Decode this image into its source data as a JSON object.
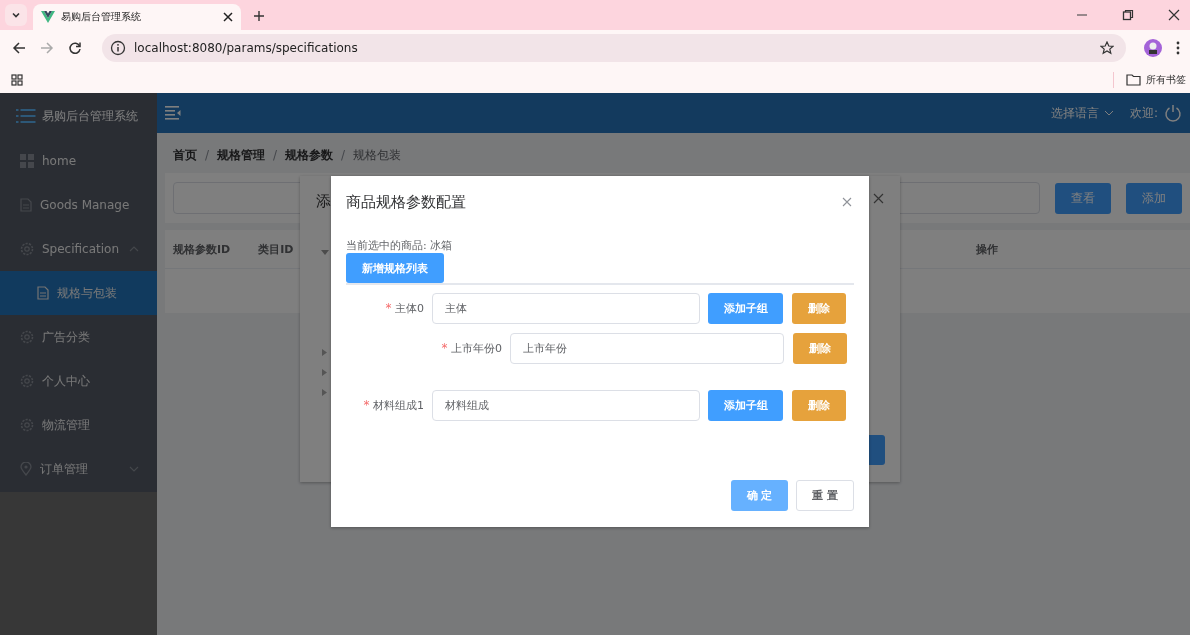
{
  "browser": {
    "tab_title": "易购后台管理系统",
    "url": "localhost:8080/params/specifications",
    "bookmarks_label": "所有书签"
  },
  "sidebar": {
    "title": "易购后台管理系统",
    "items": [
      {
        "label": "home",
        "kind": "grid",
        "selected": false
      },
      {
        "label": "Goods Manage",
        "kind": "doc",
        "selected": false
      },
      {
        "label": "Specification",
        "kind": "gear",
        "selected": false,
        "expanded": true,
        "children": [
          {
            "label": "规格与包装",
            "selected": true
          }
        ]
      },
      {
        "label": "广告分类",
        "kind": "gear",
        "selected": false
      },
      {
        "label": "个人中心",
        "kind": "gear",
        "selected": false
      },
      {
        "label": "物流管理",
        "kind": "gear",
        "selected": false
      },
      {
        "label": "订单管理",
        "kind": "pin",
        "selected": false,
        "expanded": false
      }
    ]
  },
  "header": {
    "language": "选择语言",
    "welcome": "欢迎:"
  },
  "breadcrumb": [
    {
      "label": "首页",
      "current": false
    },
    {
      "separator": "/",
      "label": "规格管理",
      "current": false
    },
    {
      "separator": "/",
      "label": "规格参数",
      "current": false
    },
    {
      "separator": "/",
      "label": "规格包装",
      "current": true
    }
  ],
  "search": {
    "buttons": [
      "查看",
      "添加"
    ]
  },
  "table": {
    "columns": [
      "规格参数ID",
      "类目ID",
      "操作"
    ]
  },
  "background_dialog": {
    "title": "添"
  },
  "modal": {
    "title": "商品规格参数配置",
    "current_item": "当前选中的商品: 冰箱",
    "add_list_button": "新增规格列表",
    "specs": [
      {
        "required_mark": "*",
        "label": "主体0",
        "value": "主体",
        "add_label": "添加子组",
        "delete_label": "删除",
        "children": [
          {
            "required_mark": "*",
            "label": "上市年份0",
            "value": "上市年份",
            "delete_label": "删除"
          }
        ]
      },
      {
        "required_mark": "*",
        "label": "材料组成1",
        "value": "材料组成",
        "add_label": "添加子组",
        "delete_label": "删除"
      }
    ],
    "confirm": "确 定",
    "reset": "重 置"
  }
}
